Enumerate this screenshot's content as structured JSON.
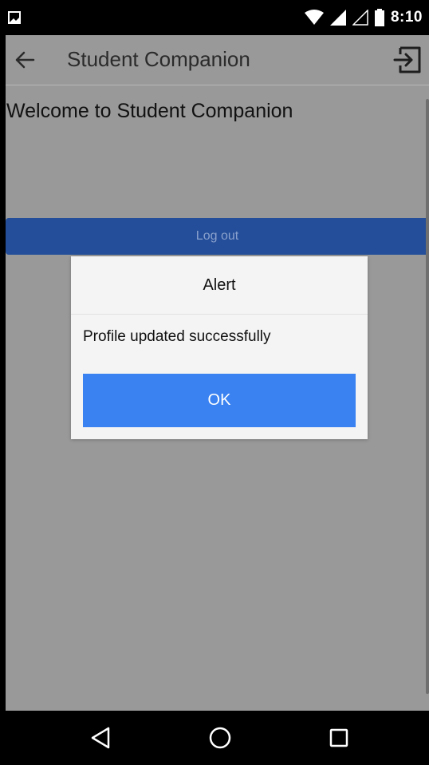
{
  "status_bar": {
    "time": "8:10",
    "icons": [
      "gallery-icon",
      "wifi-icon",
      "signal-full-icon",
      "signal-empty-icon",
      "battery-icon"
    ]
  },
  "app_bar": {
    "title": "Student Companion",
    "back_icon": "arrow-left-icon",
    "action_icon": "exit-icon"
  },
  "main": {
    "welcome_text": "Welcome to Student Companion",
    "logout_label": "Log out"
  },
  "dialog": {
    "title": "Alert",
    "message": "Profile updated successfully",
    "ok_label": "OK"
  },
  "nav_bar": {
    "icons": [
      "back-triangle-icon",
      "home-circle-icon",
      "recents-square-icon"
    ]
  },
  "colors": {
    "overlay_background": "#999999",
    "logout_button": "#244e99",
    "ok_button": "#3a82f1",
    "dialog_background": "#f4f4f4",
    "system_bars": "#000000"
  }
}
